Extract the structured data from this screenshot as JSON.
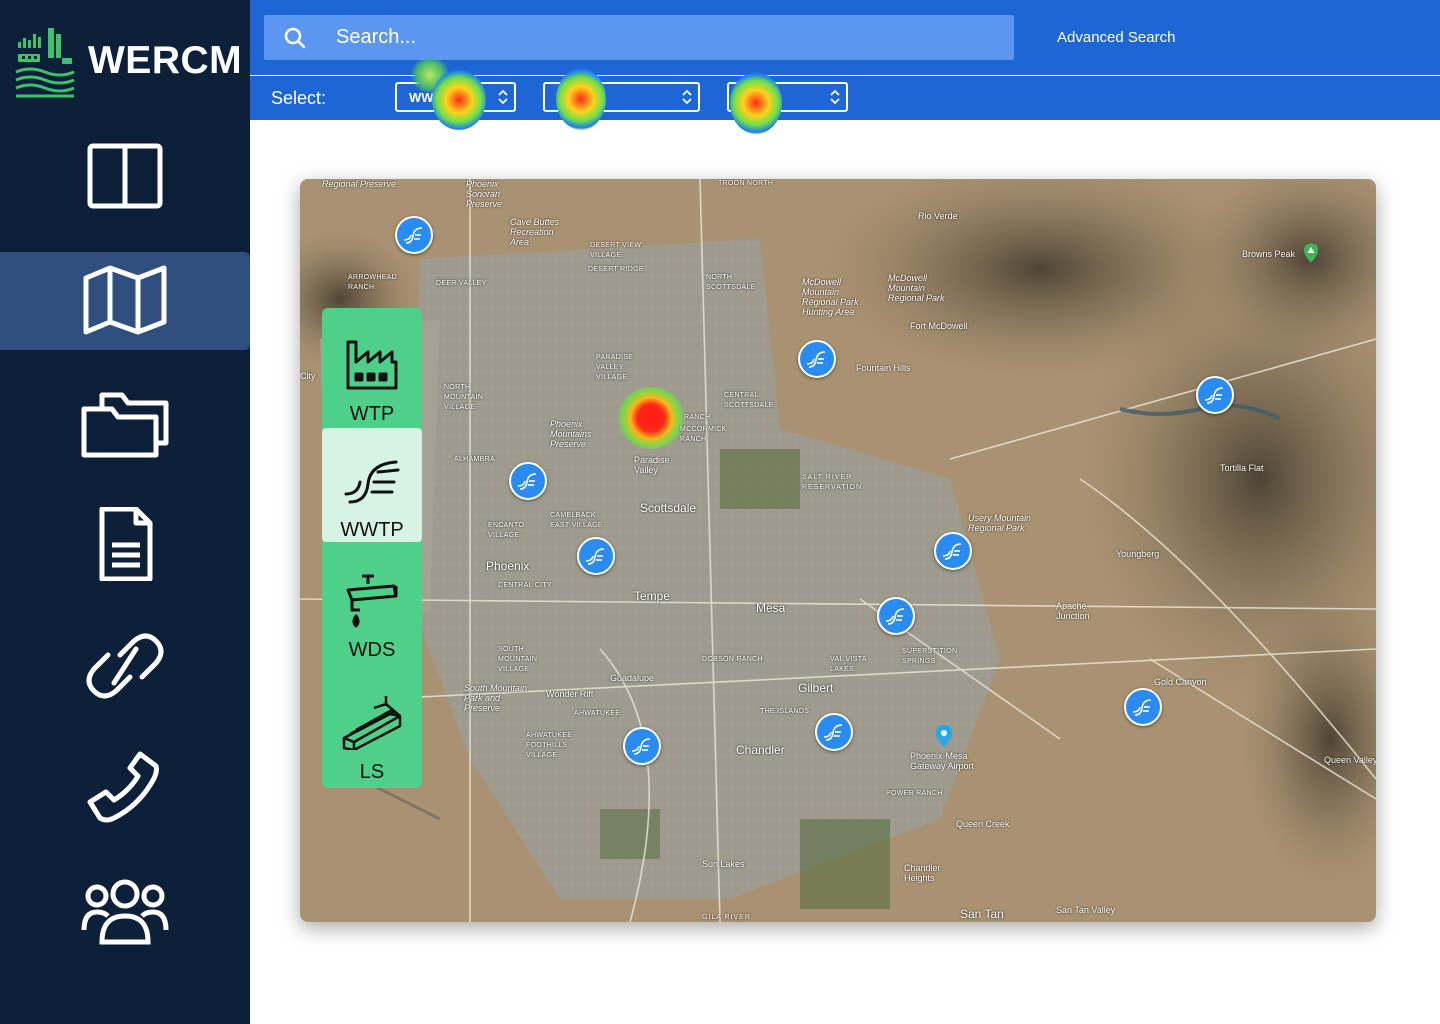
{
  "app": {
    "brand": "WERCM"
  },
  "colors": {
    "sidebar": "#0c203a",
    "header": "#1e66d6",
    "search": "#5b97f0",
    "layer_panel": "#4fd08a",
    "marker": "#2a8cf0"
  },
  "search": {
    "placeholder": "Search...",
    "advanced_label": "Advanced Search"
  },
  "selectbar": {
    "label": "Select:",
    "selects": [
      {
        "value": "WW"
      },
      {
        "value": "F"
      },
      {
        "value": "n"
      }
    ]
  },
  "sidebar": {
    "items": [
      {
        "icon": "layout-columns-icon"
      },
      {
        "icon": "map-icon",
        "active": true
      },
      {
        "icon": "folders-icon"
      },
      {
        "icon": "document-icon"
      },
      {
        "icon": "link-icon"
      },
      {
        "icon": "phone-icon"
      },
      {
        "icon": "users-icon"
      }
    ]
  },
  "layers": [
    {
      "label": "WTP",
      "icon": "factory-icon"
    },
    {
      "label": "WWTP",
      "icon": "wastewater-icon",
      "active": true
    },
    {
      "label": "WDS",
      "icon": "faucet-icon"
    },
    {
      "label": "LS",
      "icon": "lift-station-icon"
    }
  ],
  "map": {
    "places": {
      "regional_preserve": "Regional Preserve",
      "phoenix_sonoran": "Phoenix Sonoran Preserve",
      "cave_buttes": "Cave Buttes Recreation Area",
      "desert_view": "DESERT VIEW VILLAGE",
      "desert_ridge": "DESERT RIDGE",
      "troon_north": "TROON NORTH",
      "rio_verde": "Rio Verde",
      "arrowhead": "ARROWHEAD RANCH",
      "deer_valley": "DEER VALLEY",
      "north_scottsdale": "NORTH SCOTTSDALE",
      "mcdowell_hunting": "McDowell Mountain Regional Park Hunting Area",
      "mcdowell_park": "McDowell Mountain Regional Park",
      "browns_peak": "Browns Peak",
      "fort_mcdowell": "Fort McDowell",
      "fountain_hills": "Fountain Hills",
      "paradise_valley_village": "PARADISE VALLEY VILLAGE",
      "north_mountain": "NORTH MOUNTAIN VILLAGE",
      "central_scottsdale": "CENTRAL SCOTTSDALE",
      "ranch": "RANCH",
      "mccormick": "MCCORMICK RANCH",
      "phoenix_mountains": "Phoenix Mountains Preserve",
      "paradise_valley": "Paradise Valley",
      "alhambra": "ALHAMBRA",
      "salt_river": "SALT RIVER RESERVATION",
      "tortilla_flat": "Tortilla Flat",
      "camelback": "CAMELBACK EAST VILLAGE",
      "encanto": "ENCANTO VILLAGE",
      "scottsdale": "Scottsdale",
      "usery": "Usery Mountain Regional Park",
      "youngberg": "Youngberg",
      "phoenix": "Phoenix",
      "central_city": "CENTRAL CITY",
      "tempe": "Tempe",
      "mesa": "Mesa",
      "apache_junction": "Apache Junction",
      "south_mountain_village": "SOUTH MOUNTAIN VILLAGE",
      "dobson_ranch": "DOBSON RANCH",
      "val_vista": "VAL VISTA LAKES",
      "superstition": "SUPERSTITION SPRINGS",
      "guadalupe": "Guadalupe",
      "south_mountain_park": "South Mountain Park and Preserve",
      "wonder_rift": "Wonder Rift",
      "ahwatukee": "AHWATUKEE",
      "gilbert": "Gilbert",
      "gold_canyon": "Gold Canyon",
      "the_islands": "THE ISLANDS",
      "ahwatukee_foothills": "AHWATUKEE FOOTHILLS VILLAGE",
      "chandler": "Chandler",
      "phoenix_mesa_gateway": "Phoenix-Mesa Gateway Airport",
      "queen_valley": "Queen Valley",
      "power_ranch": "POWER RANCH",
      "queen_creek": "Queen Creek",
      "sun_lakes": "Sun Lakes",
      "chandler_heights": "Chandler Heights",
      "gila_river": "GILA RIVER",
      "san_tan": "San Tan",
      "san_tan_valley": "San Tan Valley",
      "city": "City"
    }
  }
}
